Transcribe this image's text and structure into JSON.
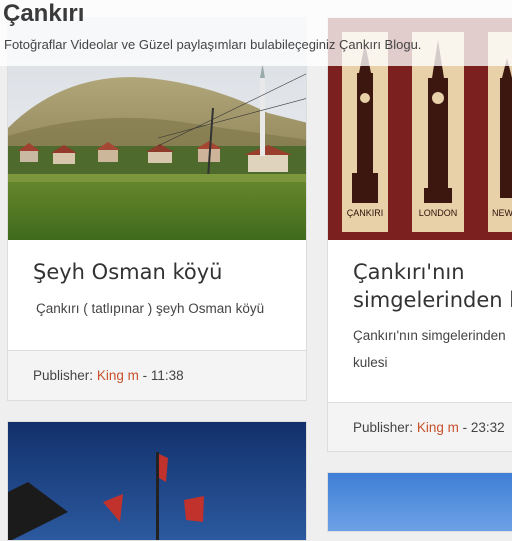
{
  "site": {
    "title": "Çankırı",
    "description": "Fotoğraflar Videolar ve Güzel paylaşımları bulabileçeginiz Çankırı Blogu."
  },
  "posts": [
    {
      "title": "Şeyh Osman köyü",
      "excerpt": "Çankırı ( tatlıpınar ) şeyh Osman köyü",
      "meta": {
        "publisher_label": "Publisher:",
        "author": "King m",
        "separator": "-",
        "time": "11:38"
      }
    },
    {
      "title_line1": "Çankırı'nın",
      "title_line2": "simgelerinden b",
      "excerpt_line1": "Çankırı'nın simgelerinden",
      "excerpt_line2": "kulesi",
      "image_labels": [
        "ÇANKIRI",
        "LONDON",
        "NEW"
      ],
      "meta": {
        "publisher_label": "Publisher:",
        "author": "King m",
        "separator": "-",
        "time": "23:32"
      }
    }
  ]
}
